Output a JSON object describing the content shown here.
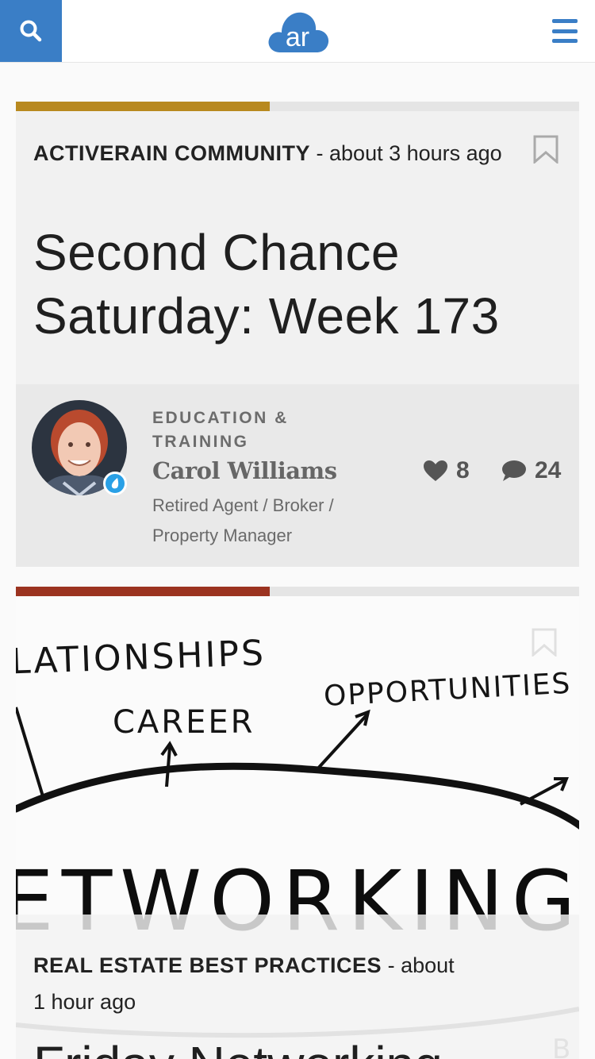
{
  "header": {
    "logo_text": "ar",
    "colors": {
      "brand": "#3a7ec6"
    }
  },
  "posts": [
    {
      "category": "ACTIVERAIN COMMUNITY",
      "time": "about 3 hours ago",
      "title_line1": "Second Chance",
      "title_line2": "Saturday: Week 173",
      "progress_fraction": 0.45,
      "progress_color": "#b8891f",
      "topic_line1": "EDUCATION &",
      "topic_line2": "TRAINING",
      "author": "Carol Williams",
      "role": "Retired Agent / Broker / Property Manager",
      "likes": "8",
      "comments": "24"
    },
    {
      "category": "REAL ESTATE BEST PRACTICES",
      "time_line1": "about",
      "time_line2": "1 hour ago",
      "title": "Friday Networking",
      "progress_fraction": 0.45,
      "progress_color": "#9b3320",
      "image_words": {
        "w1": "LATIONSHIPS",
        "w2": "CAREER",
        "w3": "OPPORTUNITIES",
        "w4": "ETWORKING",
        "w5": "B"
      }
    }
  ]
}
